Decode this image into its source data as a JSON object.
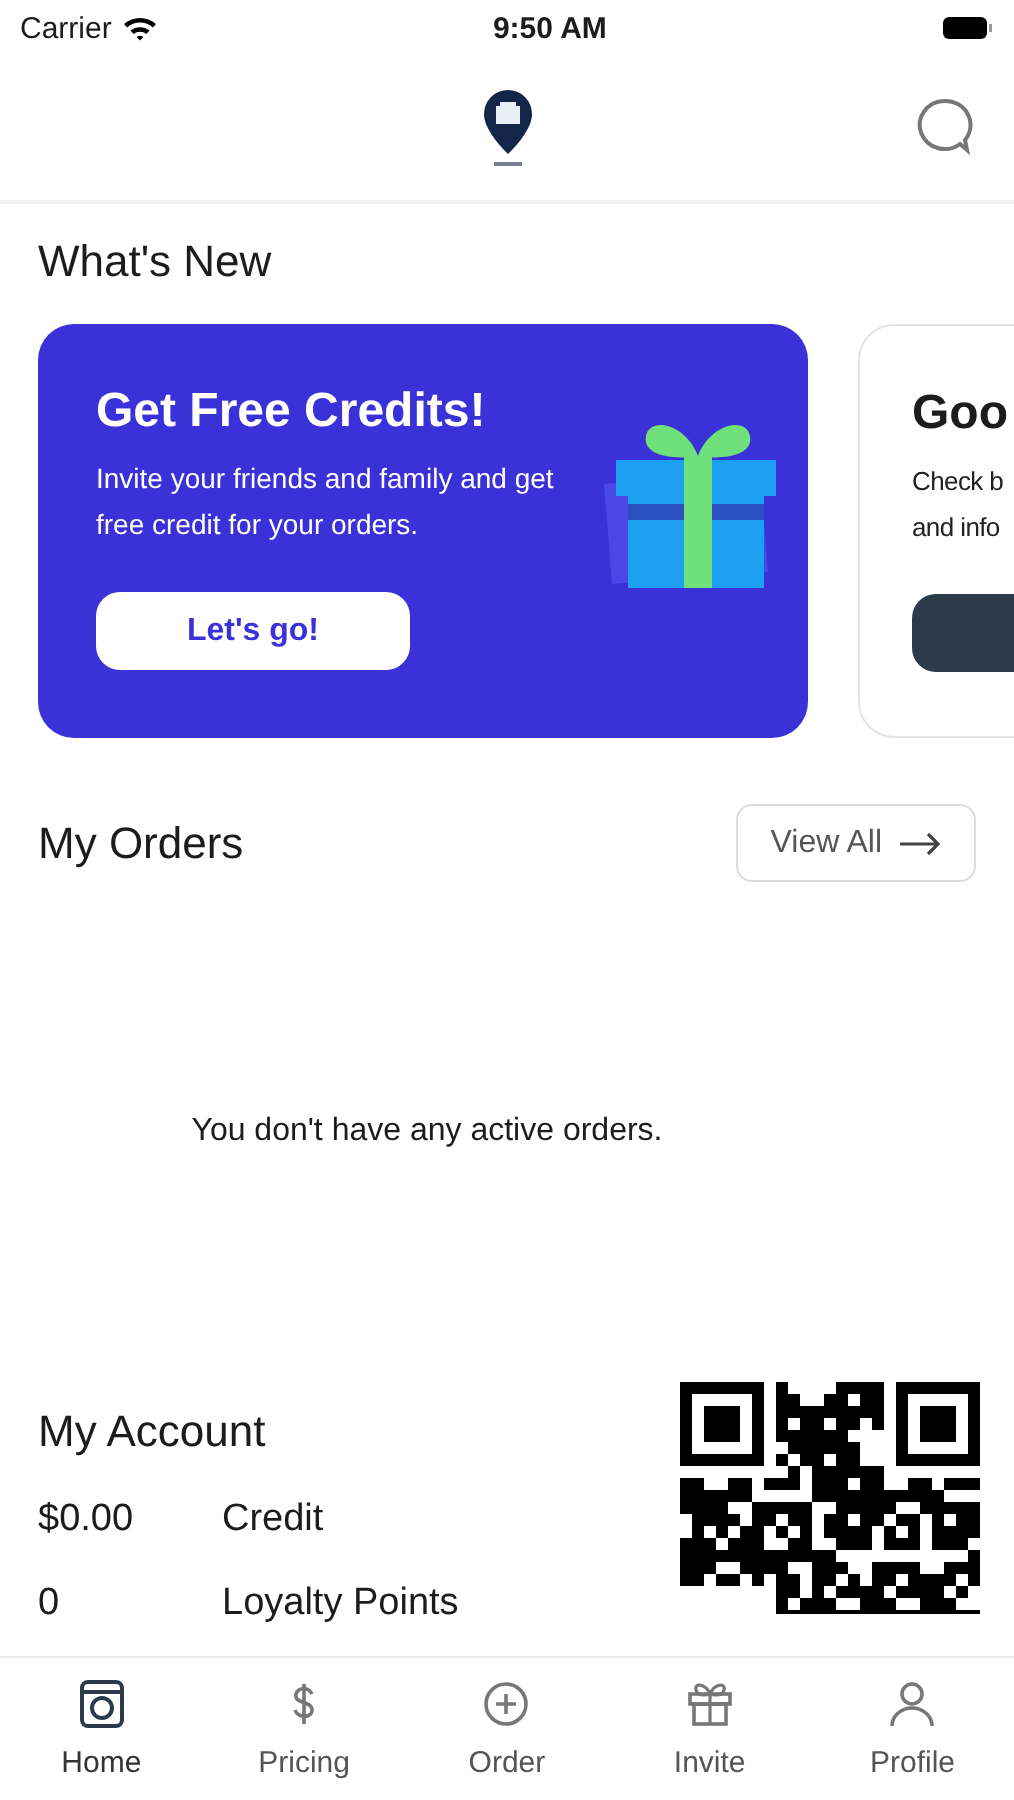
{
  "status_bar": {
    "carrier": "Carrier",
    "time": "9:50 AM"
  },
  "whats_new": {
    "title": "What's New",
    "cards": [
      {
        "kind": "promo",
        "title": "Get Free Credits!",
        "text": "Invite your friends and family and get free credit for your orders.",
        "button": "Let's go!"
      },
      {
        "kind": "info",
        "title": "Goo",
        "lines": [
          "Check b",
          "and info"
        ]
      }
    ]
  },
  "orders": {
    "title": "My Orders",
    "view_all": "View All",
    "empty": "You don't have any active orders."
  },
  "account": {
    "title": "My Account",
    "rows": [
      {
        "value": "$0.00",
        "label": "Credit"
      },
      {
        "value": "0",
        "label": "Loyalty Points"
      }
    ]
  },
  "tabs": [
    {
      "label": "Home",
      "selected": true
    },
    {
      "label": "Pricing",
      "selected": false
    },
    {
      "label": "Order",
      "selected": false
    },
    {
      "label": "Invite",
      "selected": false
    },
    {
      "label": "Profile",
      "selected": false
    }
  ]
}
